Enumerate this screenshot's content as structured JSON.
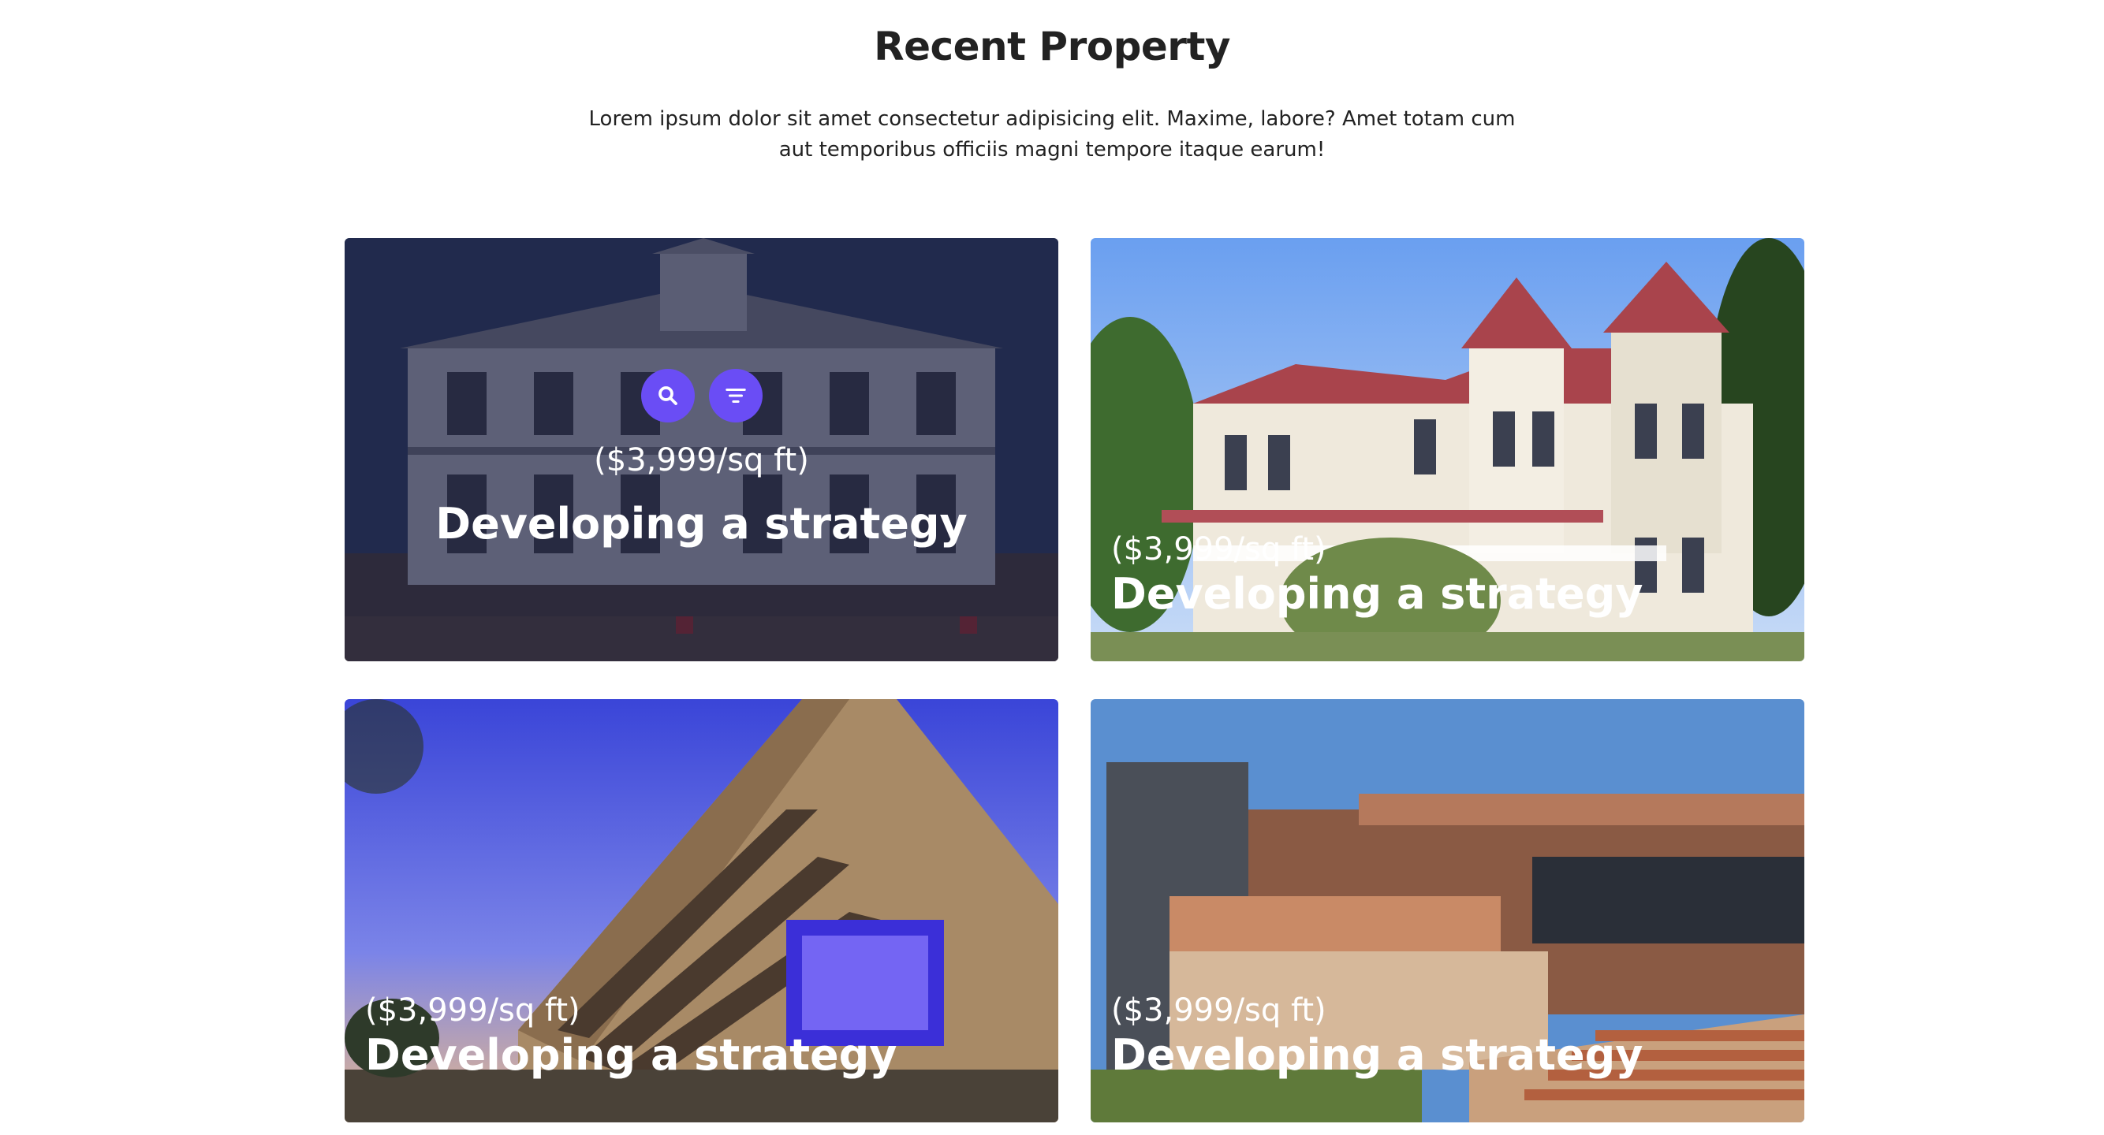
{
  "section": {
    "title": "Recent Property",
    "description": "Lorem ipsum dolor sit amet consectetur adipisicing elit. Maxime, labore? Amet totam cum aut temporibus officiis magni tempore itaque earum!"
  },
  "colors": {
    "accent": "#6a4df5",
    "overlay": "#12163c",
    "heading": "#222222"
  },
  "cards": [
    {
      "price": "($3,999/sq ft)",
      "title": "Developing a strategy",
      "image": "white-colonial-house-with-porch",
      "state": "hover",
      "actions": [
        {
          "icon": "search-icon"
        },
        {
          "icon": "filter-icon"
        }
      ]
    },
    {
      "price": "($3,999/sq ft)",
      "title": "Developing a strategy",
      "image": "victorian-house-red-roof"
    },
    {
      "price": "($3,999/sq ft)",
      "title": "Developing a strategy",
      "image": "apartment-building-at-dusk"
    },
    {
      "price": "($3,999/sq ft)",
      "title": "Developing a strategy",
      "image": "brick-university-building"
    }
  ]
}
